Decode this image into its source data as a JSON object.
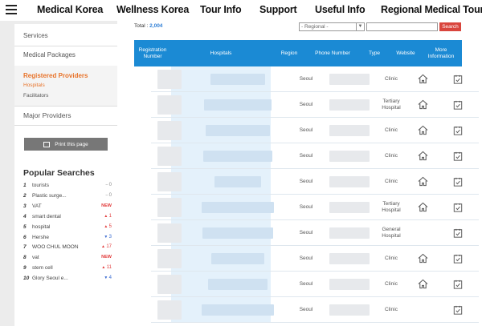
{
  "nav": {
    "items": [
      "Medical Korea",
      "Wellness Korea",
      "Tour Info",
      "Support",
      "Useful Info",
      "Regional Medical Tourism"
    ]
  },
  "sidebar": {
    "services": "Services",
    "medical_packages": "Medical Packages",
    "registered_providers": "Registered Providers",
    "hospitals": "Hospitals",
    "facilitators": "Facilitators",
    "major_providers": "Major Providers",
    "print_label": "Print this page"
  },
  "popular": {
    "title": "Popular Searches",
    "items": [
      {
        "rank": "1",
        "term": "tourists",
        "change": "0",
        "dir": "same"
      },
      {
        "rank": "2",
        "term": "Plastic surge...",
        "change": "0",
        "dir": "same"
      },
      {
        "rank": "3",
        "term": "VAT",
        "change": "NEW",
        "dir": "new"
      },
      {
        "rank": "4",
        "term": "smart dental",
        "change": "1",
        "dir": "up"
      },
      {
        "rank": "5",
        "term": "hospital",
        "change": "5",
        "dir": "up"
      },
      {
        "rank": "6",
        "term": "Hershe",
        "change": "3",
        "dir": "down"
      },
      {
        "rank": "7",
        "term": "WOO CHUL MOON",
        "change": "17",
        "dir": "up"
      },
      {
        "rank": "8",
        "term": "vat",
        "change": "NEW",
        "dir": "new"
      },
      {
        "rank": "9",
        "term": "stem cell",
        "change": "11",
        "dir": "up"
      },
      {
        "rank": "10",
        "term": "Glory Seoul e...",
        "change": "4",
        "dir": "down"
      }
    ]
  },
  "main": {
    "total_label": "Total :",
    "total_value": "2,004",
    "region_select": "- Regional -",
    "search_button": "Search",
    "headers": [
      "Registration Number",
      "Hospitals",
      "Region",
      "Phone Number",
      "Type",
      "Website",
      "More Information"
    ],
    "rows": [
      {
        "region": "Seoul",
        "type": "Clinic",
        "website": true
      },
      {
        "region": "Seoul",
        "type": "Tertiary Hospital",
        "website": true
      },
      {
        "region": "Seoul",
        "type": "Clinic",
        "website": true
      },
      {
        "region": "Seoul",
        "type": "Clinic",
        "website": true
      },
      {
        "region": "Seoul",
        "type": "Clinic",
        "website": true
      },
      {
        "region": "Seoul",
        "type": "Tertiary Hospital",
        "website": true
      },
      {
        "region": "Seoul",
        "type": "General Hospital",
        "website": false
      },
      {
        "region": "Seoul",
        "type": "Clinic",
        "website": true
      },
      {
        "region": "Seoul",
        "type": "Clinic",
        "website": true
      },
      {
        "region": "Seoul",
        "type": "Clinic",
        "website": false
      }
    ]
  }
}
